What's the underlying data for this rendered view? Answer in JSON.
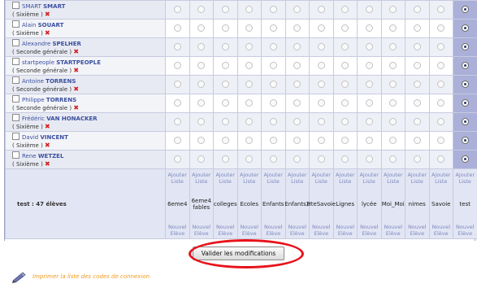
{
  "students": [
    {
      "first": "SMART",
      "last": "SMART",
      "classe": "( Sixième )"
    },
    {
      "first": "Alain",
      "last": "SOUART",
      "classe": "( Sixième )"
    },
    {
      "first": "Alexandre",
      "last": "SPELHER",
      "classe": "( Seconde générale )"
    },
    {
      "first": "startpeople",
      "last": "STARTPEOPLE",
      "classe": "( Seconde générale )"
    },
    {
      "first": "Antoine",
      "last": "TORRENS",
      "classe": "( Seconde générale )"
    },
    {
      "first": "Philippe",
      "last": "TORRENS",
      "classe": "( Seconde générale )"
    },
    {
      "first": "Frédéric",
      "last": "VAN HONACKER",
      "classe": "( Sixième )"
    },
    {
      "first": "David",
      "last": "VINCENT",
      "classe": "( Sixième )"
    },
    {
      "first": "Rene",
      "last": "WETZEL",
      "classe": "( Sixième )"
    }
  ],
  "summary": "test : 47 élèves",
  "add_list_label": "Ajouter Liste",
  "new_student_label": "Nouvel Elève",
  "groups": [
    "6eme4",
    "6eme4 fables",
    "colleges",
    "Ecoles",
    "Enfants",
    "Enfants2",
    "HteSavoie",
    "Lignes",
    "lycée",
    "Moi_Moi",
    "nimes",
    "Savoie",
    "test"
  ],
  "validate_button": "Valider les modifications",
  "print_link": "Imprimer la liste des codes de connexion",
  "colors": {
    "accent_column": "#aab0d8",
    "link": "#f09a1a",
    "circle": "#e8121a"
  }
}
